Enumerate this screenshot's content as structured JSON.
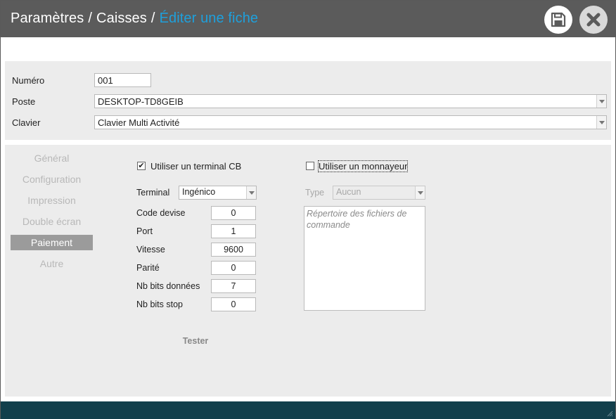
{
  "header": {
    "crumb1": "Paramètres",
    "crumb2": "Caisses",
    "separator": "/",
    "current": "Éditer une fiche",
    "save_icon": "floppy-disk-icon",
    "close_icon": "close-x-icon"
  },
  "top_form": {
    "numero_label": "Numéro",
    "numero_value": "001",
    "poste_label": "Poste",
    "poste_value": "DESKTOP-TD8GEIB",
    "clavier_label": "Clavier",
    "clavier_value": "Clavier Multi Activité"
  },
  "sidebar": {
    "items": [
      {
        "label": "Général",
        "active": false
      },
      {
        "label": "Configuration",
        "active": false
      },
      {
        "label": "Impression",
        "active": false
      },
      {
        "label": "Double écran",
        "active": false
      },
      {
        "label": "Paiement",
        "active": true
      },
      {
        "label": "Autre",
        "active": false
      }
    ]
  },
  "payment": {
    "use_terminal_label": "Utiliser un terminal CB",
    "use_terminal_checked": true,
    "use_changer_label": "Utiliser un monnayeur",
    "use_changer_checked": false,
    "terminal_label": "Terminal",
    "terminal_value": "Ingénico",
    "code_devise_label": "Code devise",
    "code_devise_value": "0",
    "port_label": "Port",
    "port_value": "1",
    "vitesse_label": "Vitesse",
    "vitesse_value": "9600",
    "parite_label": "Parité",
    "parite_value": "0",
    "nb_bits_donnees_label": "Nb bits données",
    "nb_bits_donnees_value": "7",
    "nb_bits_stop_label": "Nb bits stop",
    "nb_bits_stop_value": "0",
    "test_button": "Tester",
    "type_label": "Type",
    "type_value": "Aucun",
    "repertoire_placeholder": "Répertoire des fichiers de commande"
  },
  "colors": {
    "titlebar": "#5b5b5b",
    "accent": "#1ea0dc",
    "footer": "#123f4b",
    "panel": "#ececec",
    "nav_active": "#9b9b9b"
  }
}
